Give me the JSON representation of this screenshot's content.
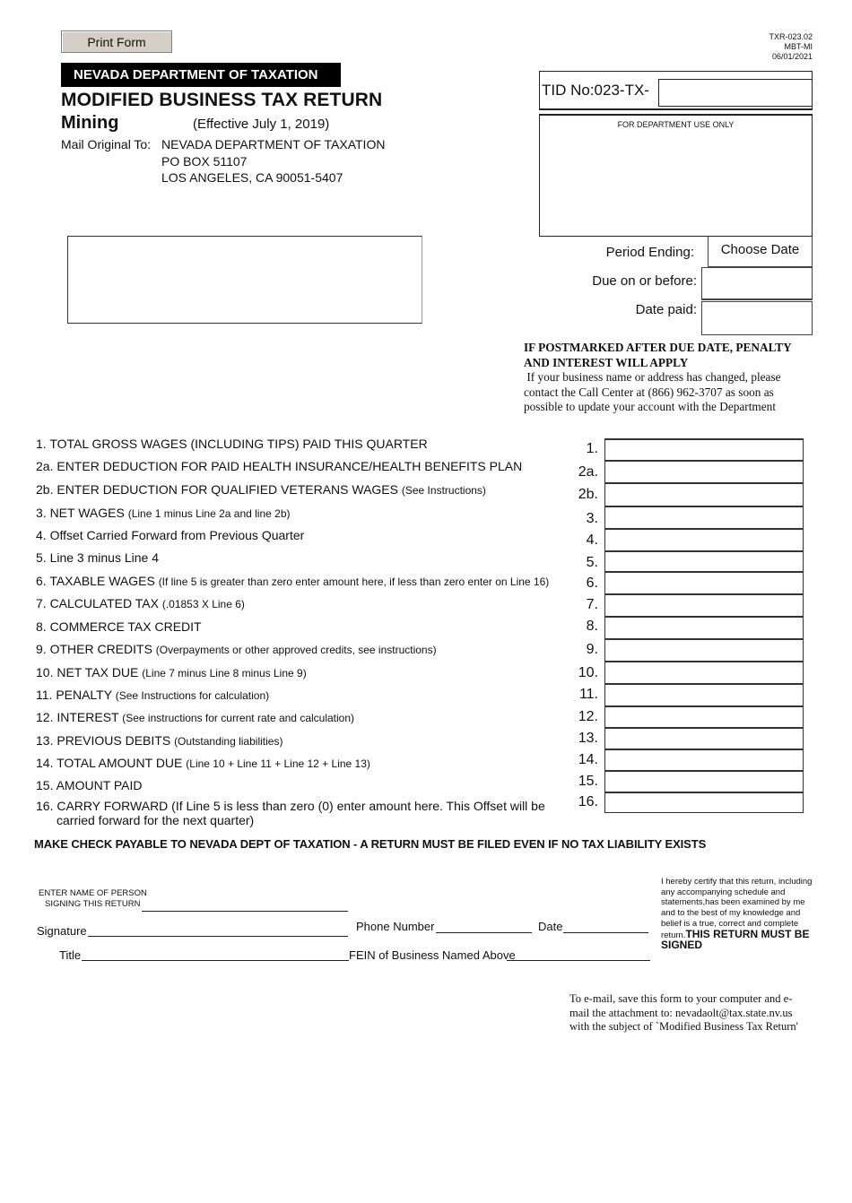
{
  "header": {
    "print_button": "Print Form",
    "form_code": [
      "TXR-023.02",
      "MBT-MI",
      "06/01/2021"
    ],
    "department": "NEVADA DEPARTMENT OF TAXATION",
    "title": "MODIFIED BUSINESS TAX RETURN",
    "subtitle": "Mining",
    "effective": "(Effective July 1, 2019)",
    "mail_label": "Mail Original To:",
    "mail_address": [
      "NEVADA DEPARTMENT OF TAXATION",
      "PO BOX 51107",
      "LOS ANGELES, CA 90051-5407"
    ]
  },
  "account": {
    "tid_label": "TID No:023-TX-",
    "tid_value": "",
    "dept_use_label": "FOR DEPARTMENT USE ONLY",
    "period_ending_label": "Period Ending:",
    "period_ending_value": "Choose Date",
    "due_label": "Due on or before:",
    "due_value": "",
    "date_paid_label": "Date paid:",
    "date_paid_value": ""
  },
  "notice": {
    "bold": "IF POSTMARKED AFTER DUE DATE, PENALTY AND INTEREST WILL APPLY",
    "text": "If your business name or address has changed, please contact the Call Center at (866) 962-3707 as soon as possible to update your account with the Department"
  },
  "lines": [
    {
      "num": "1.",
      "main": "1. TOTAL GROSS WAGES (INCLUDING TIPS) PAID THIS QUARTER",
      "sub": "",
      "value": ""
    },
    {
      "num": "2a.",
      "main": "2a. ENTER DEDUCTION FOR PAID HEALTH INSURANCE/HEALTH BENEFITS PLAN",
      "sub": "",
      "value": ""
    },
    {
      "num": "2b.",
      "main": "2b. ENTER DEDUCTION FOR QUALIFIED VETERANS WAGES ",
      "sub": "(See Instructions)",
      "value": ""
    },
    {
      "num": "3.",
      "main": "3.  NET WAGES ",
      "sub": "(Line 1 minus Line 2a and line 2b)",
      "value": ""
    },
    {
      "num": "4.",
      "main": "4.  Offset Carried Forward from Previous Quarter",
      "sub": "",
      "value": ""
    },
    {
      "num": "5.",
      "main": "5.  Line 3 minus Line 4",
      "sub": "",
      "value": ""
    },
    {
      "num": "6.",
      "main": "6.  TAXABLE WAGES ",
      "sub": "(If line 5 is greater than zero enter amount here, if less than zero enter on Line 16)",
      "value": ""
    },
    {
      "num": "7.",
      "main": "7.  CALCULATED TAX ",
      "sub": "(.01853  X Line 6)",
      "value": ""
    },
    {
      "num": "8.",
      "main": "8.  COMMERCE TAX CREDIT",
      "sub": "",
      "value": ""
    },
    {
      "num": "9.",
      "main": "9.  OTHER CREDITS ",
      "sub": "(Overpayments or other approved credits, see instructions)",
      "value": ""
    },
    {
      "num": "10.",
      "main": "10. NET TAX DUE ",
      "sub": "(Line 7 minus Line 8 minus Line 9)",
      "value": ""
    },
    {
      "num": "11.",
      "main": "11. PENALTY ",
      "sub": "(See Instructions for calculation)",
      "value": ""
    },
    {
      "num": "12.",
      "main": "12. INTEREST ",
      "sub": "(See instructions for current rate and calculation)",
      "value": ""
    },
    {
      "num": "13.",
      "main": "13. PREVIOUS DEBITS ",
      "sub": "(Outstanding liabilities)",
      "value": ""
    },
    {
      "num": "14.",
      "main": "14. TOTAL AMOUNT DUE ",
      "sub": "(Line 10 + Line 11 + Line 12 + Line 13)",
      "value": ""
    },
    {
      "num": "15.",
      "main": "15. AMOUNT PAID",
      "sub": "",
      "value": ""
    },
    {
      "num": "16.",
      "main": "16. CARRY FORWARD (If Line 5 is less than zero (0) enter amount here. This Offset will be",
      "main2": "carried forward for the next quarter)",
      "sub": "",
      "value": ""
    }
  ],
  "check_note": "MAKE CHECK PAYABLE TO NEVADA DEPT OF TAXATION - A RETURN MUST BE FILED EVEN IF NO TAX LIABILITY EXISTS",
  "signature": {
    "name_label_1": "ENTER NAME OF PERSON",
    "name_label_2": "SIGNING THIS RETURN",
    "signature_label": "Signature",
    "phone_label": "Phone Number",
    "date_label": "Date",
    "title_label": "Title",
    "fein_label": "FEIN of Business Named Above",
    "certify_text": "I hereby certify that this return, including any accompanying schedule and statements,has been examined by me and to the best of my knowledge and belief is a true, correct and complete return.",
    "certify_bold": "THIS RETURN MUST BE SIGNED"
  },
  "email_note": "To e-mail, save this form to your computer and e-mail the attachment to: nevadaolt@tax.state.nv.us with the subject of `Modified Business Tax Return'"
}
